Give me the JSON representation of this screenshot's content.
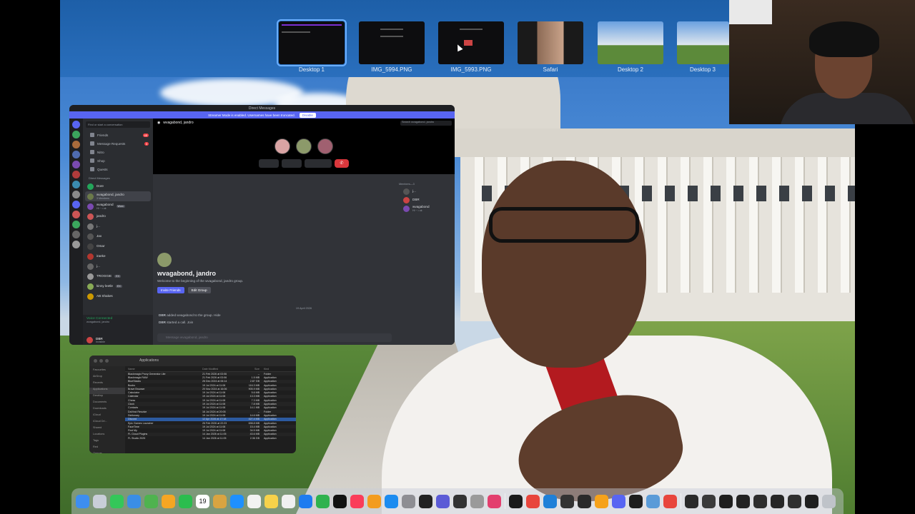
{
  "spaces": [
    {
      "label": "Desktop 1",
      "active": true
    },
    {
      "label": "IMG_5994.PNG"
    },
    {
      "label": "IMG_5993.PNG"
    },
    {
      "label": "Safari"
    },
    {
      "label": "Desktop 2"
    },
    {
      "label": "Desktop 3"
    }
  ],
  "discord": {
    "window_title": "Direct Messages",
    "banner_text": "Streamer Mode is enabled. Usernames have been truncated.",
    "banner_button": "Disable",
    "search_placeholder": "Find or start a conversation",
    "nav": [
      {
        "label": "Friends",
        "badge": "45"
      },
      {
        "label": "Message Requests",
        "badge": "3"
      },
      {
        "label": "Nitro"
      },
      {
        "label": "Shop"
      },
      {
        "label": "Quests"
      }
    ],
    "dm_heading": "Direct Messages",
    "dms": [
      {
        "name": "Dore",
        "color": "#23a55a"
      },
      {
        "name": "wvagabond, jandro",
        "sub": "3 Members",
        "selected": true,
        "color": "#6b7a4a"
      },
      {
        "name": "wvagabond",
        "sub": "Hi ~ • ok",
        "tag": "Worx",
        "color": "#7a4ab0"
      },
      {
        "name": "jandro",
        "color": "#c55"
      },
      {
        "name": "j...",
        "color": "#777"
      },
      {
        "name": "Jax",
        "color": "#555"
      },
      {
        "name": "Omar",
        "color": "#444"
      },
      {
        "name": "iraeke",
        "color": "#b3372f"
      },
      {
        "name": "j...",
        "color": "#666"
      },
      {
        "name": "TROGGIE",
        "tag": "EX",
        "color": "#999"
      },
      {
        "name": "kinny leetle",
        "tag": "EX",
        "color": "#8a5"
      },
      {
        "name": "AB Shakes",
        "color": "#c90"
      }
    ],
    "voice_status": "Voice Connected",
    "voice_channel": "wvagabond, jandro",
    "user_name": "DBR",
    "user_status": "Invisible",
    "channel_title": "wvagabond, jandro",
    "header_search": "Search wvagabond, jandro",
    "members_heading": "Members—3",
    "members": [
      {
        "name": "j...",
        "sub": ""
      },
      {
        "name": "DBR",
        "sub": ""
      },
      {
        "name": "wvagabond",
        "sub": "Hi ~ • ok"
      }
    ],
    "welcome_title": "wvagabond, jandro",
    "welcome_text": "Welcome to the beginning of the wvagabond, jandro group.",
    "invite_button": "Invite Friends",
    "edit_button": "Edit Group",
    "date_divider": "19 April 2026",
    "system_messages": [
      {
        "user": "DBR",
        "text": "added wvagabond to the group. Hide"
      },
      {
        "user": "DBR",
        "text": "started a call. Join"
      }
    ],
    "input_placeholder": "Message wvagabond, jandro"
  },
  "finder": {
    "title": "Applications",
    "sidebar": [
      "Favourites",
      "AirDrop",
      "Recents",
      "Applications",
      "Desktop",
      "Documents",
      "Downloads",
      "iCloud",
      "iCloud Dri...",
      "Shared",
      "Locations",
      "Tags",
      "Red",
      "Orange"
    ],
    "columns": {
      "name": "Name",
      "date": "Date Modified",
      "size": "Size",
      "kind": "Kind"
    },
    "rows": [
      {
        "name": "Blackmagic Proxy Generator Lite",
        "date": "21 Feb 2026 at 03:06",
        "size": "--",
        "kind": "Folder"
      },
      {
        "name": "Blackmagic RAW",
        "date": "21 Feb 2026 at 03:06",
        "size": "1.5 MB",
        "kind": "Application"
      },
      {
        "name": "BlueStacks",
        "date": "26 Dec 2024 at 06:14",
        "size": "2.87 GB",
        "kind": "Application"
      },
      {
        "name": "Books",
        "date": "19 Jul 2024 at 11:08",
        "size": "116.3 MB",
        "kind": "Application"
      },
      {
        "name": "Brave Browser",
        "date": "20 Nov 2024 at 16:06",
        "size": "905.9 MB",
        "kind": "Application"
      },
      {
        "name": "Calculator",
        "date": "19 Jul 2024 at 11:08",
        "size": "5.6 MB",
        "kind": "Application"
      },
      {
        "name": "Calendar",
        "date": "19 Jul 2024 at 11:08",
        "size": "13.3 MB",
        "kind": "Application"
      },
      {
        "name": "Chess",
        "date": "19 Jul 2024 at 11:08",
        "size": "7.3 MB",
        "kind": "Application"
      },
      {
        "name": "Clock",
        "date": "19 Jul 2024 at 11:08",
        "size": "7.8 MB",
        "kind": "Application"
      },
      {
        "name": "Contacts",
        "date": "19 Jul 2024 at 11:08",
        "size": "14.1 MB",
        "kind": "Application"
      },
      {
        "name": "DaVinci Resolve",
        "date": "16 Jul 2024 at 20:05",
        "size": "--",
        "kind": "Folder"
      },
      {
        "name": "Dictionary",
        "date": "19 Jul 2024 at 11:08",
        "size": "14.6 MB",
        "kind": "Application"
      },
      {
        "name": "Discord",
        "date": "12 Apr 2026 at 17:18",
        "size": "427.4 MB",
        "kind": "Application",
        "selected": true
      },
      {
        "name": "Epic Games Launcher",
        "date": "26 Feb 2026 at 22:23",
        "size": "698.8 MB",
        "kind": "Application"
      },
      {
        "name": "FaceTime",
        "date": "19 Jul 2024 at 11:08",
        "size": "15.4 MB",
        "kind": "Application"
      },
      {
        "name": "Find My",
        "date": "19 Jul 2024 at 11:08",
        "size": "34.5 MB",
        "kind": "Application"
      },
      {
        "name": "FL Cloud Plugins",
        "date": "14 Jan 2026 at 11:05",
        "size": "43.6 MB",
        "kind": "Application"
      },
      {
        "name": "FL Studio 2025",
        "date": "14 Jan 2026 at 11:05",
        "size": "2.36 GB",
        "kind": "Application"
      }
    ]
  },
  "dock": {
    "calendar_day": "19",
    "icons": [
      {
        "name": "finder-icon",
        "color": "#3d8ef0"
      },
      {
        "name": "launchpad-icon",
        "color": "#c9ced8"
      },
      {
        "name": "messages-icon",
        "color": "#34c759"
      },
      {
        "name": "mail-icon",
        "color": "#3a8ee6"
      },
      {
        "name": "maps-icon",
        "color": "#4fb34f"
      },
      {
        "name": "photos-icon",
        "color": "#f5a623"
      },
      {
        "name": "facetime-icon",
        "color": "#2bbd4e"
      },
      {
        "name": "calendar-icon",
        "color": "#ffffff"
      },
      {
        "name": "folder-icon",
        "color": "#d9a441"
      },
      {
        "name": "safari-icon",
        "color": "#1e90ff"
      },
      {
        "name": "reminders-icon",
        "color": "#f2f2f2"
      },
      {
        "name": "notes-icon",
        "color": "#f7d24a"
      },
      {
        "name": "freeform-icon",
        "color": "#f0f0f0"
      },
      {
        "name": "keynote-icon",
        "color": "#1e7cf0"
      },
      {
        "name": "numbers-icon",
        "color": "#2fb24f"
      },
      {
        "name": "tv-icon",
        "color": "#111111"
      },
      {
        "name": "music-icon",
        "color": "#fa3c5a"
      },
      {
        "name": "pages-icon",
        "color": "#f39c1f"
      },
      {
        "name": "app-store-icon",
        "color": "#1c8cf0"
      },
      {
        "name": "system-settings-icon",
        "color": "#8e8e93"
      },
      {
        "name": "capcut-icon",
        "color": "#222222"
      },
      {
        "name": "screenshot-icon",
        "color": "#5b5bd6"
      },
      {
        "name": "unity-icon",
        "color": "#333333"
      },
      {
        "name": "help-icon",
        "color": "#9a9a9a"
      },
      {
        "name": "toybox-icon",
        "color": "#e33f6e"
      },
      {
        "name": "terminal-icon",
        "color": "#1a1a1a"
      },
      {
        "name": "chrome-icon",
        "color": "#e8453c"
      },
      {
        "name": "vscode-icon",
        "color": "#1f80d8"
      },
      {
        "name": "game-icon",
        "color": "#333333"
      },
      {
        "name": "monitor-icon",
        "color": "#2a2a2a"
      },
      {
        "name": "fl-studio-icon",
        "color": "#f6a21b"
      },
      {
        "name": "discord-icon",
        "color": "#5865f2"
      },
      {
        "name": "activity-monitor-icon",
        "color": "#1d1d1d"
      },
      {
        "name": "preview-icon",
        "color": "#5a9bd8"
      },
      {
        "name": "chrome-2-icon",
        "color": "#e8453c"
      }
    ],
    "recents": [
      "#2a2a2a",
      "#3a3a3a",
      "#1e1e1e",
      "#222",
      "#2d2d2d",
      "#262626",
      "#303030",
      "#1f1f1f"
    ],
    "trash_color": "#bfc3c9"
  }
}
